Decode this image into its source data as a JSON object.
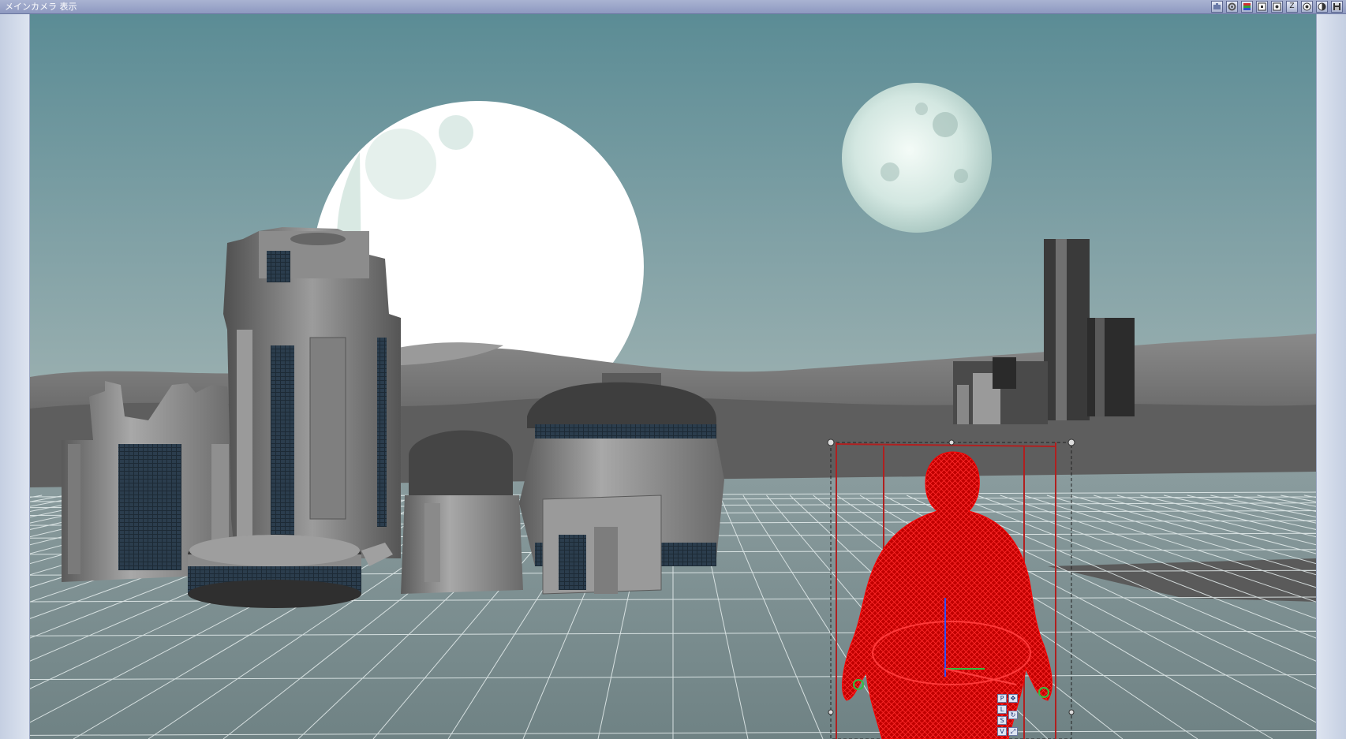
{
  "window": {
    "title": "メインカメラ 表示"
  },
  "toolbar": {
    "buttons": [
      {
        "name": "camera-view-button",
        "icon": "camera-icon",
        "label": ""
      },
      {
        "name": "settings-button",
        "icon": "gear-icon",
        "label": ""
      },
      {
        "name": "color-button",
        "icon": "color-bars-icon",
        "label": ""
      },
      {
        "name": "render-button",
        "icon": "square-dot-icon",
        "label": ""
      },
      {
        "name": "shading-button",
        "icon": "square-dot-icon",
        "label": ""
      },
      {
        "name": "z-buffer-button",
        "icon": "z-icon",
        "label": "Z"
      },
      {
        "name": "display-mode-button",
        "icon": "circle-icon",
        "label": ""
      },
      {
        "name": "contrast-button",
        "icon": "half-circle-icon",
        "label": ""
      },
      {
        "name": "save-button",
        "icon": "floppy-icon",
        "label": ""
      }
    ]
  },
  "viewport": {
    "sky_top": "#5b8c95",
    "sky_bottom": "#a7b6b4",
    "grid_color": "#e8f0f0",
    "floor_color": "#78898b",
    "selected_wireframe_color": "#e00000",
    "gizmo_labels": [
      "P",
      "L",
      "S",
      "V"
    ]
  }
}
